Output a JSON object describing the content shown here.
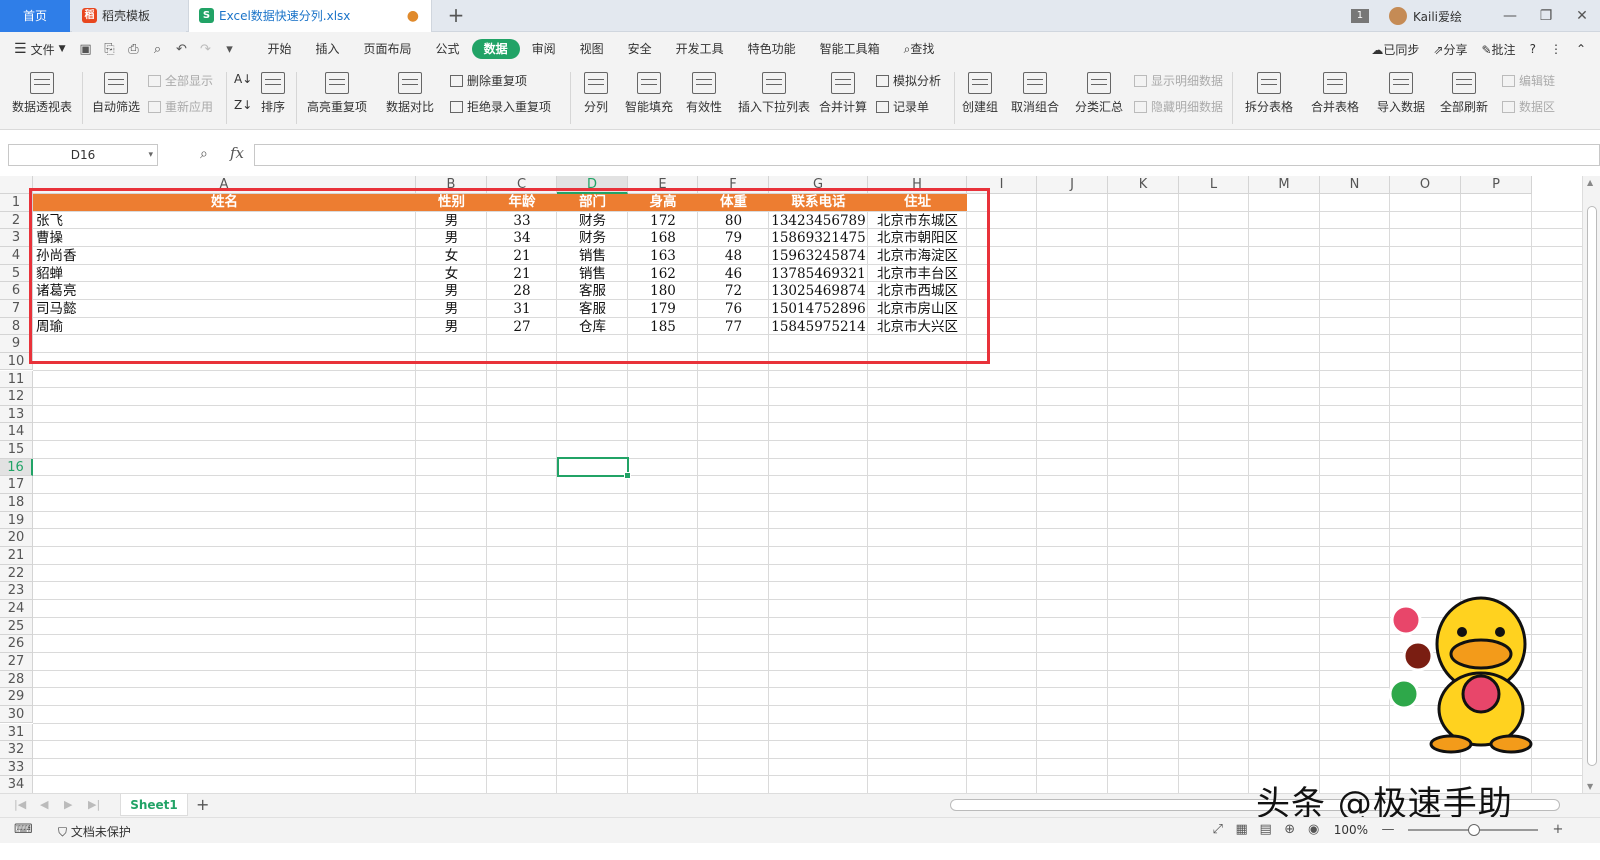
{
  "tabs": {
    "home": "首页",
    "template": "稻壳模板",
    "file": "Excel数据快速分列.xlsx"
  },
  "titlebar": {
    "page_count": "1",
    "user": "Kaili爱绘"
  },
  "menu": {
    "file": "文件",
    "tabs": [
      "开始",
      "插入",
      "页面布局",
      "公式",
      "数据",
      "审阅",
      "视图",
      "安全",
      "开发工具",
      "特色功能",
      "智能工具箱"
    ],
    "active": "数据",
    "search": "查找",
    "sync": "已同步",
    "share": "分享",
    "annotate": "批注"
  },
  "ribbon": {
    "pivot": "数据透视表",
    "autofilter": "自动筛选",
    "show_all": "全部显示",
    "reapply": "重新应用",
    "sort": "排序",
    "highlight_dup": "高亮重复项",
    "compare": "数据对比",
    "remove_dup": "删除重复项",
    "reject_dup": "拒绝录入重复项",
    "split": "分列",
    "smart_fill": "智能填充",
    "validity": "有效性",
    "insert_dropdown": "插入下拉列表",
    "merge_calc": "合并计算",
    "simulate": "模拟分析",
    "record": "记录单",
    "create_group": "创建组",
    "ungroup": "取消组合",
    "subtotal": "分类汇总",
    "show_detail": "显示明细数据",
    "hide_detail": "隐藏明细数据",
    "split_table": "拆分表格",
    "merge_table": "合并表格",
    "import_data": "导入数据",
    "refresh_all": "全部刷新",
    "edit_link": "编辑链",
    "data_source": "数据区"
  },
  "formula": {
    "cell_ref": "D16",
    "fx": "fx",
    "value": ""
  },
  "columns": [
    "A",
    "B",
    "C",
    "D",
    "E",
    "F",
    "G",
    "H",
    "I",
    "J",
    "K",
    "L",
    "M",
    "N",
    "O",
    "P"
  ],
  "selected_column": "D",
  "selected_row": 16,
  "row_count": 34,
  "table": {
    "headers": [
      "姓名",
      "性别",
      "年龄",
      "部门",
      "身高",
      "体重",
      "联系电话",
      "住址"
    ],
    "rows": [
      [
        "张飞",
        "男",
        "33",
        "财务",
        "172",
        "80",
        "13423456789",
        "北京市东城区"
      ],
      [
        "曹操",
        "男",
        "34",
        "财务",
        "168",
        "79",
        "15869321475",
        "北京市朝阳区"
      ],
      [
        "孙尚香",
        "女",
        "21",
        "销售",
        "163",
        "48",
        "15963245874",
        "北京市海淀区"
      ],
      [
        "貂蝉",
        "女",
        "21",
        "销售",
        "162",
        "46",
        "13785469321",
        "北京市丰台区"
      ],
      [
        "诸葛亮",
        "男",
        "28",
        "客服",
        "180",
        "72",
        "13025469874",
        "北京市西城区"
      ],
      [
        "司马懿",
        "男",
        "31",
        "客服",
        "179",
        "76",
        "15014752896",
        "北京市房山区"
      ],
      [
        "周瑜",
        "男",
        "27",
        "仓库",
        "185",
        "77",
        "15845975214",
        "北京市大兴区"
      ]
    ]
  },
  "sheetbar": {
    "sheet": "Sheet1"
  },
  "statusbar": {
    "protect": "文档未保护",
    "zoom": "100%"
  },
  "watermark": "头条 @极速手助",
  "colors": {
    "header_fill": "#ed7d31",
    "accent": "#21a366",
    "highlight_box": "#e8323a",
    "home_tab": "#2f7ee8"
  }
}
